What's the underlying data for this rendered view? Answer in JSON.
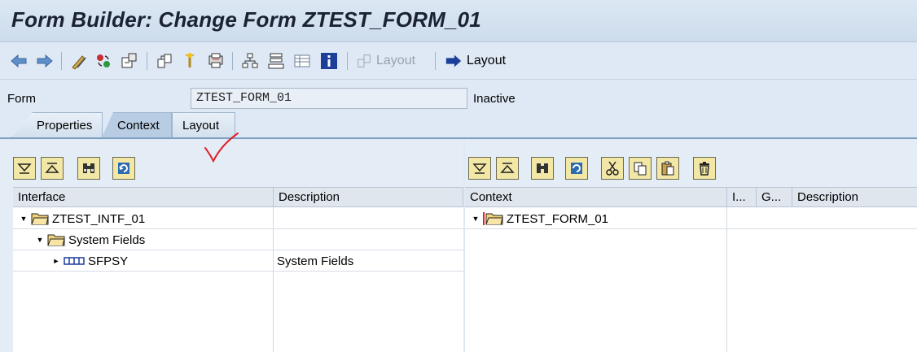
{
  "window": {
    "title": "Form Builder: Change Form ZTEST_FORM_01"
  },
  "toolbar": {
    "layout_disabled_label": "Layout",
    "layout_label": "Layout"
  },
  "form": {
    "label": "Form",
    "value": "ZTEST_FORM_01",
    "status": "Inactive"
  },
  "tabs": [
    {
      "label": "Properties"
    },
    {
      "label": "Context"
    },
    {
      "label": "Layout"
    }
  ],
  "interface_grid": {
    "headers": [
      "Interface",
      "Description"
    ],
    "rows": [
      {
        "name": "ZTEST_INTF_01",
        "description": ""
      },
      {
        "name": "System Fields",
        "description": ""
      },
      {
        "name": "SFPSY",
        "description": "System Fields"
      }
    ]
  },
  "context_grid": {
    "headers": [
      "Context",
      "I...",
      "G...",
      "Description"
    ],
    "rows": [
      {
        "name": "ZTEST_FORM_01"
      }
    ]
  },
  "colors": {
    "accent_blue": "#1d3f9a",
    "annotation_red": "#e0202a"
  }
}
